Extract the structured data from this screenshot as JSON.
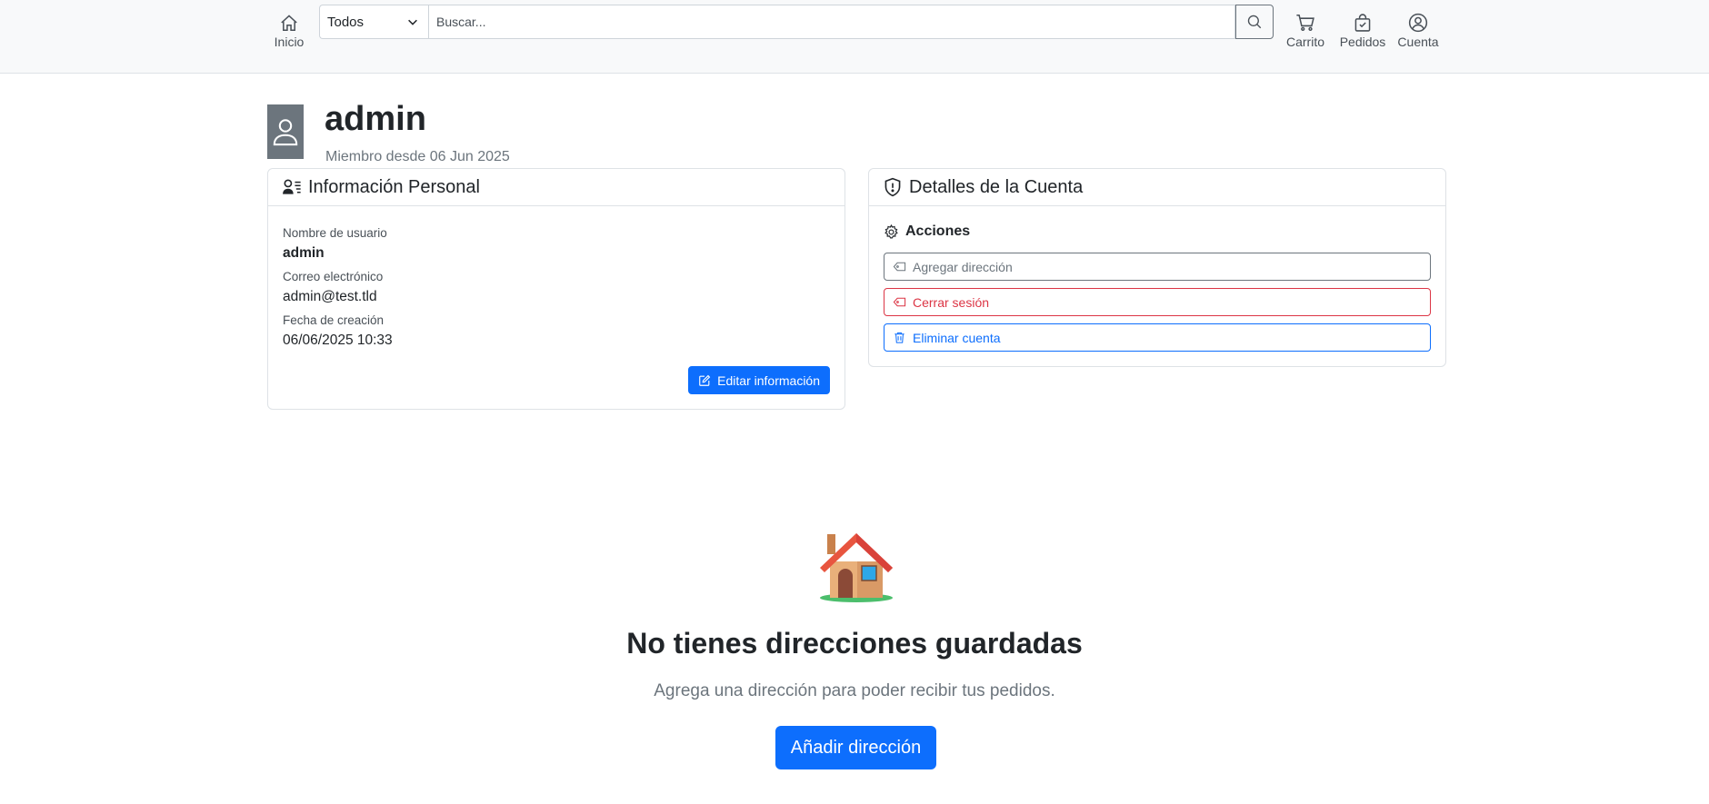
{
  "nav": {
    "home_label": "Inicio",
    "cart_label": "Carrito",
    "orders_label": "Pedidos",
    "account_label": "Cuenta"
  },
  "search": {
    "category_selected": "Todos",
    "placeholder": "Buscar...",
    "value": ""
  },
  "profile": {
    "username": "admin",
    "member_since": "Miembro desde 06 Jun 2025"
  },
  "personal_info": {
    "title": "Información Personal",
    "username_label": "Nombre de usuario",
    "username_value": "admin",
    "email_label": "Correo electrónico",
    "email_value": "admin@test.tld",
    "created_label": "Fecha de creación",
    "created_value": "06/06/2025 10:33",
    "edit_button": "Editar información"
  },
  "account_details": {
    "title": "Detalles de la Cuenta",
    "actions_title": "Acciones",
    "add_address": "Agregar dirección",
    "logout": "Cerrar sesión",
    "delete_account": "Eliminar cuenta"
  },
  "empty_addresses": {
    "icon": "house-emoji",
    "title": "No tienes direcciones guardadas",
    "subtitle": "Agrega una dirección para poder recibir tus pedidos.",
    "button": "Añadir dirección"
  },
  "colors": {
    "primary": "#0d6efd",
    "danger": "#dc3545",
    "secondary": "#6c757d",
    "navbar_bg": "#f8f9fa"
  }
}
